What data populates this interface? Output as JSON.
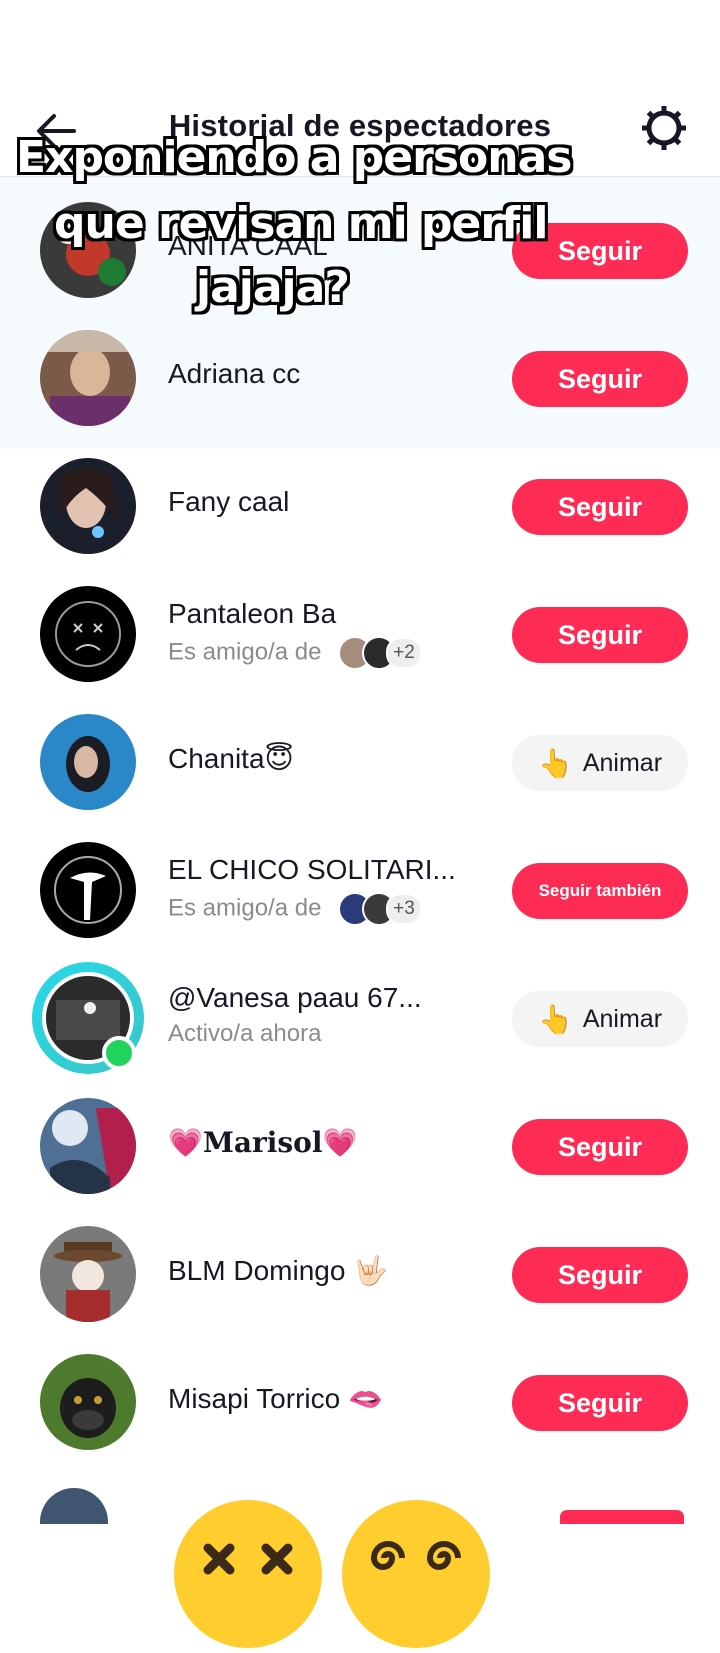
{
  "header": {
    "title": "Historial de espectadores",
    "back_icon": "arrow-left-icon",
    "settings_icon": "gear-icon"
  },
  "overlay_caption": {
    "line1": "Exponiendo a personas",
    "line2": "que revisan mi perfil",
    "line3": "jajaja?"
  },
  "viewers": [
    {
      "name": "ANITA CAAL",
      "subtitle": "",
      "button": "Seguir",
      "button_type": "follow"
    },
    {
      "name": "Adriana cc",
      "subtitle": "",
      "button": "Seguir",
      "button_type": "follow"
    },
    {
      "name": "Fany caal",
      "subtitle": "",
      "button": "Seguir",
      "button_type": "follow"
    },
    {
      "name": "Pantaleon Ba",
      "subtitle": "Es amigo/a de",
      "mutual_more": "+2",
      "button": "Seguir",
      "button_type": "follow"
    },
    {
      "name": "Chanita😇",
      "subtitle": "",
      "button": "Animar",
      "button_icon": "👆",
      "button_type": "cheer"
    },
    {
      "name": "EL CHICO SOLITARI...",
      "subtitle": "Es amigo/a de",
      "mutual_more": "+3",
      "button": "Seguir también",
      "button_type": "follow-back"
    },
    {
      "name": "@Vanesa paau 67...",
      "subtitle": "Activo/a ahora",
      "button": "Animar",
      "button_icon": "👆",
      "button_type": "cheer"
    },
    {
      "name": "💗𝐌𝐚𝐫𝐢𝐬𝐨𝐥💗",
      "subtitle": "",
      "button": "Seguir",
      "button_type": "follow"
    },
    {
      "name": "BLM Domingo 🤟🏻",
      "subtitle": "",
      "button": "Seguir",
      "button_type": "follow"
    },
    {
      "name": "Misapi Torrico 🫦",
      "subtitle": "",
      "button": "Seguir",
      "button_type": "follow"
    }
  ],
  "colors": {
    "accent": "#fe2c55",
    "online": "#20d35a",
    "highlight_bg": "#f5fafd"
  },
  "stickers": [
    "dizzy-face-emoji",
    "face-with-spiral-eyes-emoji"
  ]
}
